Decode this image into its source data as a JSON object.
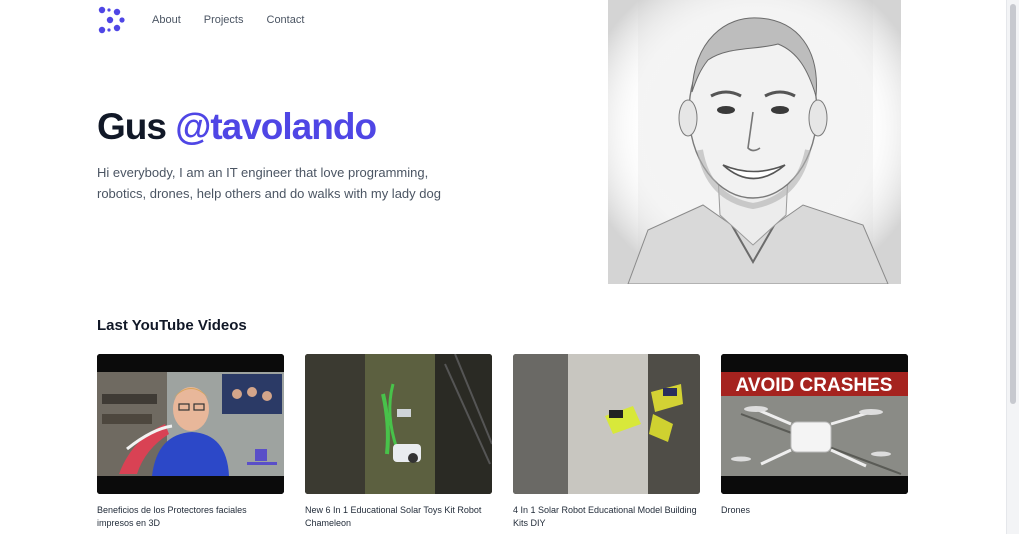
{
  "nav": {
    "logo_icon": "dots-logo-icon",
    "links": [
      "About",
      "Projects",
      "Contact"
    ]
  },
  "hero": {
    "name": "Gus",
    "handle": "@tavolando",
    "description": "Hi everybody, I am an IT engineer that love programming, robotics, drones, help others and do walks with my lady dog",
    "accent_color": "#4f46e5"
  },
  "videos_section": {
    "title": "Last YouTube Videos",
    "videos": [
      {
        "title": "Beneficios de los Protectores faciales impresos en 3D",
        "thumbnail": "person-face-shield-thumbnail"
      },
      {
        "title": "New 6 In 1 Educational Solar Toys Kit Robot Chameleon",
        "thumbnail": "solar-robot-chameleon-thumbnail"
      },
      {
        "title": "4 In 1 Solar Robot Educational Model Building Kits DIY",
        "thumbnail": "solar-robot-kit-thumbnail"
      },
      {
        "title": "Drones",
        "thumbnail": "crashed-drone-thumbnail",
        "overlay_text": "AVOID CRASHES"
      }
    ]
  }
}
